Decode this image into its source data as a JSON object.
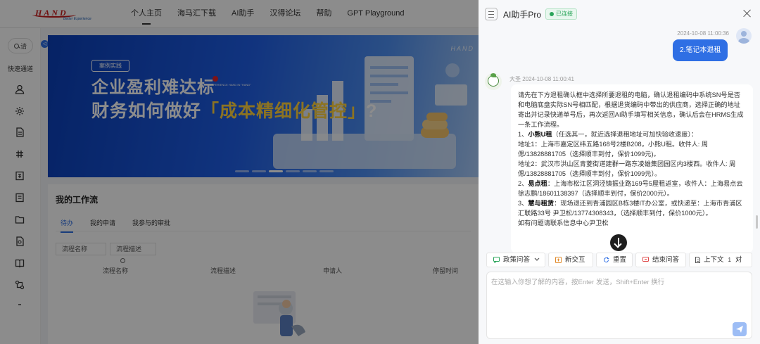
{
  "portal": {
    "logo": {
      "brand": "HAND",
      "slogan": "Better Experience"
    },
    "nav": [
      "个人主页",
      "海马汇下载",
      "AI助手",
      "汉得论坛",
      "帮助",
      "GPT Playground"
    ],
    "sidebar": {
      "search_label": "请",
      "quick_access": "快速通道",
      "toggle": "◁"
    },
    "banner": {
      "tag": "案例实践",
      "title_line1": "企业盈利难达标",
      "title_line2_prefix": "财务如何做好",
      "title_line2_highlight": "「成本精细化管控」",
      "title_line2_suffix": "?",
      "mini_logo_text": "EXPERIENCE HAND IN \"HAND\"",
      "corner_logo": "HAND"
    },
    "workflow": {
      "title": "我的工作流",
      "tabs": [
        "待办",
        "我的申请",
        "我参与的审批"
      ],
      "filters": {
        "name": "流程名称",
        "desc": "流程描述"
      },
      "columns": [
        "流程名称",
        "流程描述",
        "申请人",
        "停留时间"
      ]
    }
  },
  "chat": {
    "title": "AI助手Pro",
    "status": "已连接",
    "user_message": {
      "timestamp": "2024-10-08 11:00:36",
      "text": "2.笔记本退租"
    },
    "bot_message": {
      "author_time": "大圣 2024-10-08 11:00:41",
      "lines": [
        "请先在下方退租确认框中选择所要退租的电脑，确认退租编码中系统SN号是否和电脑底盘实际SN号相匹配，根据退货编码中带出的供应商，选择正确的地址寄出并记录快递单号后，再次返回AI助手填写相关信息，确认后会在HRMS生成一条工作流程。",
        "1、",
        "小熊U租",
        "（任选其一，就近选择退租地址可加快验收速度）：",
        "地址1：上海市嘉定区纬五路168号2楼B208，小熊U租。收件人: 周偲/13828881705（选择顺丰到付，保价1099元)。",
        "地址2：武汉市洪山区青菱街道建群一路东凌雄集团园区内3楼西。收件人: 周偲/13828881705（选择顺丰到付，保价1099元）。",
        "2、",
        "易点租",
        "：上海市松江区洞泾镇振业路169号5屋租返室，收件人：上海易点云徐志鹏/18601138397（选择顺丰到付，保价2000元）。",
        "3、",
        "慧与租赁",
        "：现场退还到青浦园区B栋3楼IT办公室，或快递至：上海市青浦区汇联路33号 尹卫松/13774308343，（选择顺丰到付，保价1000元）。",
        "如有问题请联系信息中心尹卫松"
      ]
    },
    "toolbar": {
      "policy": "政策问答",
      "new_chat": "新交互",
      "reset": "重置",
      "end": "结束问答",
      "context": "上下文",
      "context_count": "1",
      "context_unit": "对"
    },
    "input": {
      "placeholder": "在这输入你想了解的内容，按Enter 发送，Shift+Enter 换行"
    },
    "colors": {
      "accent": "#2f6fe4",
      "connected": "#2aa55a"
    }
  }
}
